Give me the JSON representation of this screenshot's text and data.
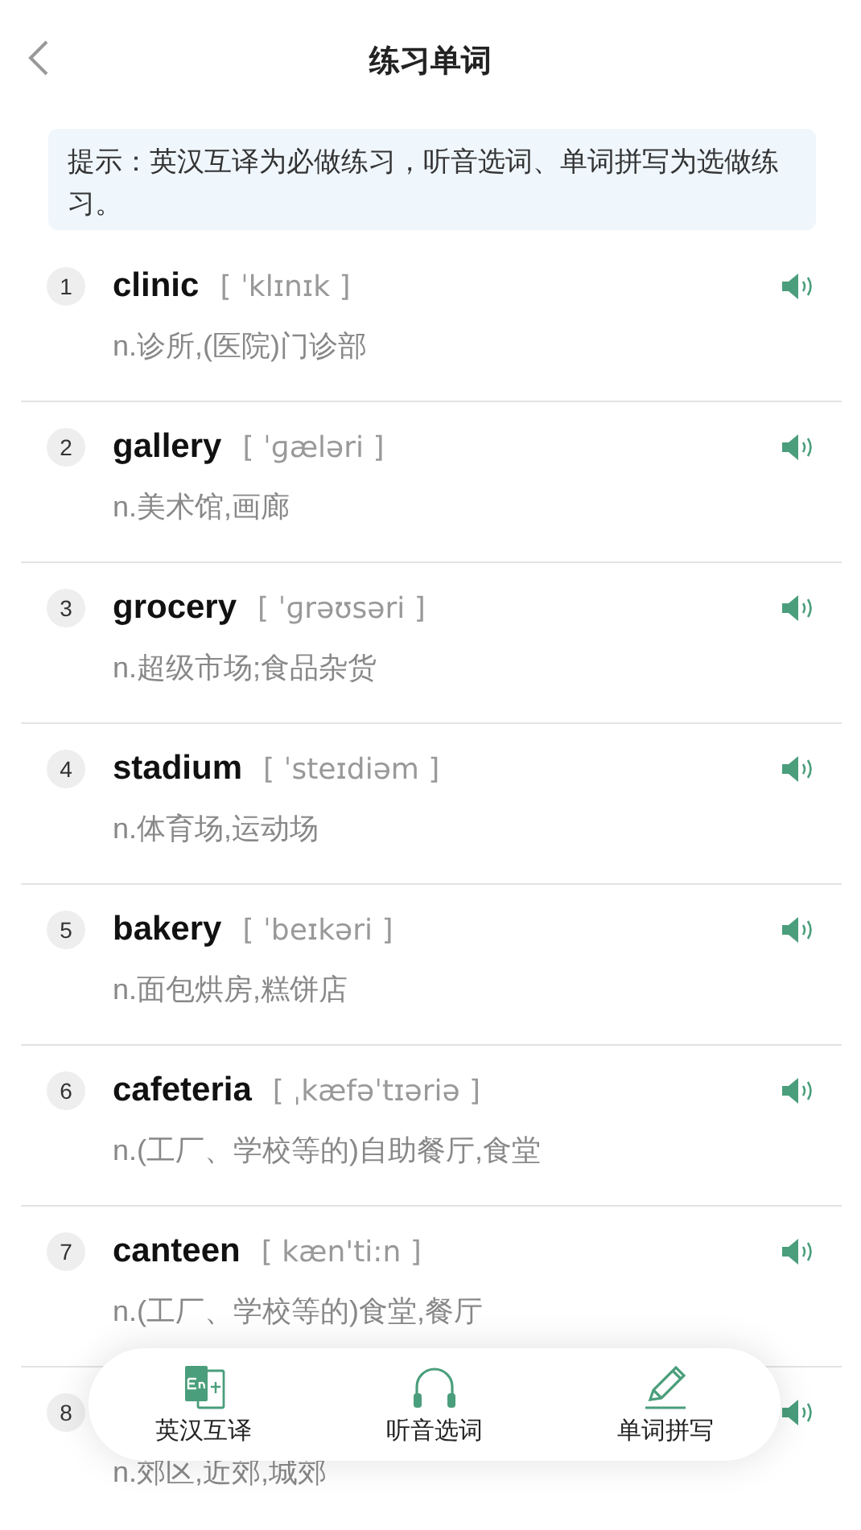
{
  "header": {
    "title": "练习单词"
  },
  "hint": "提示：英汉互译为必做练习，听音选词、单词拼写为选做练习。",
  "words": [
    {
      "number": "1",
      "word": "clinic",
      "phonetic": "[ ˈklɪnɪk ]",
      "definition": "n.诊所,(医院)门诊部"
    },
    {
      "number": "2",
      "word": "gallery",
      "phonetic": "[ ˈɡæləri ]",
      "definition": "n.美术馆,画廊"
    },
    {
      "number": "3",
      "word": "grocery",
      "phonetic": "[ ˈɡrəʊsəri ]",
      "definition": "n.超级市场;食品杂货"
    },
    {
      "number": "4",
      "word": "stadium",
      "phonetic": "[ ˈsteɪdiəm ]",
      "definition": "n.体育场,运动场"
    },
    {
      "number": "5",
      "word": "bakery",
      "phonetic": "[ ˈbeɪkəri ]",
      "definition": "n.面包烘房,糕饼店"
    },
    {
      "number": "6",
      "word": "cafeteria",
      "phonetic": "[ ˌkæfəˈtɪəriə ]",
      "definition": "n.(工厂、学校等的)自助餐厅,食堂"
    },
    {
      "number": "7",
      "word": "canteen",
      "phonetic": "[ kæn'ti:n ]",
      "definition": "n.(工厂、学校等的)食堂,餐厅"
    },
    {
      "number": "8",
      "definition": "n.郊区,近郊,城郊"
    }
  ],
  "practice_bar": [
    {
      "kind": "translate",
      "label": "英汉互译"
    },
    {
      "kind": "listen",
      "label": "听音选词"
    },
    {
      "kind": "spell",
      "label": "单词拼写"
    }
  ]
}
